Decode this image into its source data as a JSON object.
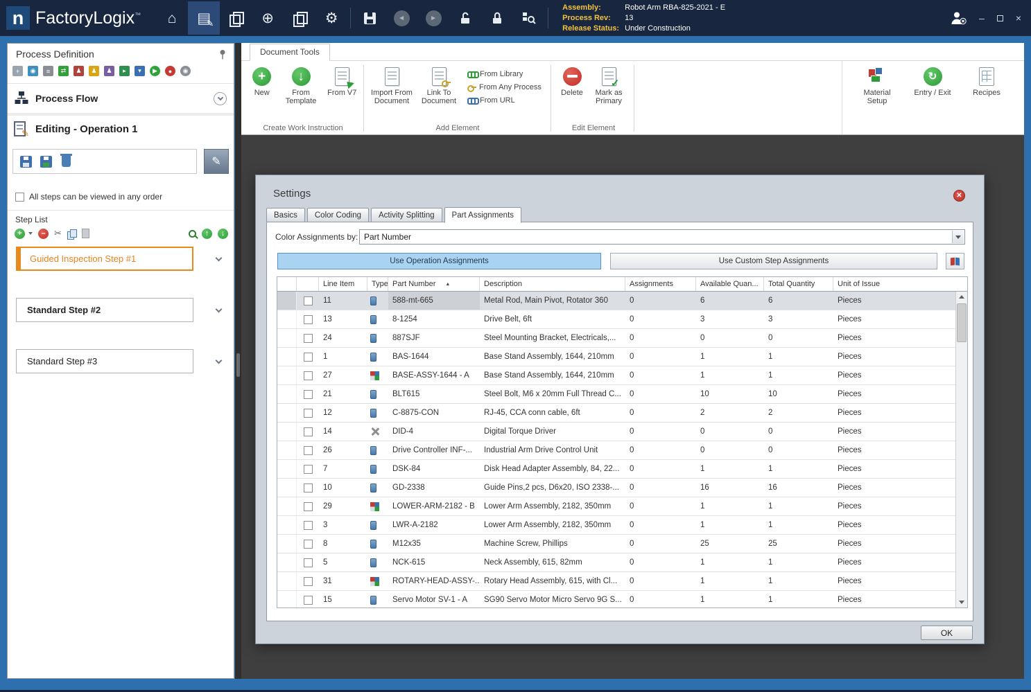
{
  "app": {
    "logo_letter": "n",
    "name": "FactoryLogix",
    "trademark": "™"
  },
  "titlebar": {
    "assembly_label": "Assembly:",
    "assembly_value": "Robot Arm RBA-825-2021 - E",
    "process_rev_label": "Process Rev:",
    "process_rev_value": "13",
    "release_status_label": "Release Status:",
    "release_status_value": "Under Construction",
    "minimize": "–",
    "close": "×"
  },
  "left_panel": {
    "title": "Process Definition",
    "process_flow_label": "Process Flow",
    "editing_label": "Editing - Operation 1",
    "order_checkbox_label": "All steps can be viewed in any order",
    "step_list_label": "Step List",
    "steps": [
      {
        "label": "Guided Inspection Step #1",
        "style": "selected"
      },
      {
        "label": "Standard Step #2",
        "style": "bold"
      },
      {
        "label": "Standard Step #3",
        "style": "normal"
      }
    ]
  },
  "ribbon": {
    "tab_label": "Document Tools",
    "groups": [
      {
        "label": "Create Work Instruction",
        "items": [
          {
            "label": "New"
          },
          {
            "label": "From Template"
          },
          {
            "label": "From V7"
          }
        ]
      },
      {
        "label": "Add Element",
        "items": [
          {
            "label": "Import From Document"
          },
          {
            "label": "Link To Document"
          }
        ],
        "small_items": [
          {
            "label": "From Library"
          },
          {
            "label": "From Any Process"
          },
          {
            "label": "From URL"
          }
        ]
      },
      {
        "label": "Edit Element",
        "items": [
          {
            "label": "Delete"
          },
          {
            "label": "Mark as Primary"
          }
        ]
      }
    ],
    "right_items": [
      {
        "label": "Material Setup"
      },
      {
        "label": "Entry / Exit"
      },
      {
        "label": "Recipes"
      }
    ]
  },
  "dialog": {
    "title": "Settings",
    "tabs": [
      {
        "label": "Basics",
        "active": false
      },
      {
        "label": "Color Coding",
        "active": false
      },
      {
        "label": "Activity Splitting",
        "active": false
      },
      {
        "label": "Part Assignments",
        "active": true
      }
    ],
    "color_by_label": "Color Assignments by:",
    "color_by_value": "Part Number",
    "use_operation_label": "Use Operation Assignments",
    "use_custom_label": "Use Custom Step Assignments",
    "ok_label": "OK",
    "sort_indicator": "▲",
    "table": {
      "columns": [
        "Line Item",
        "Type",
        "Part Number",
        "Description",
        "Assignments",
        "Available Quan...",
        "Total Quantity",
        "Unit of Issue"
      ],
      "rows": [
        {
          "line_item": "11",
          "type": "blue",
          "part_number": "588-mt-665",
          "description": "Metal Rod, Main Pivot, Rotator 360",
          "assignments": "0",
          "available": "6",
          "total": "6",
          "unit": "Pieces",
          "selected": true
        },
        {
          "line_item": "13",
          "type": "blue",
          "part_number": "8-1254",
          "description": "Drive Belt, 6ft",
          "assignments": "0",
          "available": "3",
          "total": "3",
          "unit": "Pieces",
          "selected": false
        },
        {
          "line_item": "24",
          "type": "blue",
          "part_number": "887SJF",
          "description": "Steel Mounting Bracket, Electricals,...",
          "assignments": "0",
          "available": "0",
          "total": "0",
          "unit": "Pieces",
          "selected": false
        },
        {
          "line_item": "1",
          "type": "blue",
          "part_number": "BAS-1644",
          "description": "Base Stand Assembly, 1644, 210mm",
          "assignments": "0",
          "available": "1",
          "total": "1",
          "unit": "Pieces",
          "selected": false
        },
        {
          "line_item": "27",
          "type": "multi",
          "part_number": "BASE-ASSY-1644 - A",
          "description": "Base Stand Assembly, 1644, 210mm",
          "assignments": "0",
          "available": "1",
          "total": "1",
          "unit": "Pieces",
          "selected": false
        },
        {
          "line_item": "21",
          "type": "blue",
          "part_number": "BLT615",
          "description": "Steel Bolt, M6 x 20mm Full Thread C...",
          "assignments": "0",
          "available": "10",
          "total": "10",
          "unit": "Pieces",
          "selected": false
        },
        {
          "line_item": "12",
          "type": "blue",
          "part_number": "C-8875-CON",
          "description": "RJ-45, CCA conn cable, 6ft",
          "assignments": "0",
          "available": "2",
          "total": "2",
          "unit": "Pieces",
          "selected": false
        },
        {
          "line_item": "14",
          "type": "tools",
          "part_number": "DID-4",
          "description": "Digital Torque Driver",
          "assignments": "0",
          "available": "0",
          "total": "0",
          "unit": "Pieces",
          "selected": false
        },
        {
          "line_item": "26",
          "type": "blue",
          "part_number": "Drive Controller INF-...",
          "description": "Industrial Arm Drive Control Unit",
          "assignments": "0",
          "available": "0",
          "total": "0",
          "unit": "Pieces",
          "selected": false
        },
        {
          "line_item": "7",
          "type": "blue",
          "part_number": "DSK-84",
          "description": "Disk Head Adapter Assembly, 84, 22...",
          "assignments": "0",
          "available": "1",
          "total": "1",
          "unit": "Pieces",
          "selected": false
        },
        {
          "line_item": "10",
          "type": "blue",
          "part_number": "GD-2338",
          "description": "Guide Pins,2 pcs, D6x20, ISO 2338-...",
          "assignments": "0",
          "available": "16",
          "total": "16",
          "unit": "Pieces",
          "selected": false
        },
        {
          "line_item": "29",
          "type": "multi",
          "part_number": "LOWER-ARM-2182 - B",
          "description": "Lower Arm Assembly, 2182, 350mm",
          "assignments": "0",
          "available": "1",
          "total": "1",
          "unit": "Pieces",
          "selected": false
        },
        {
          "line_item": "3",
          "type": "blue",
          "part_number": "LWR-A-2182",
          "description": "Lower Arm Assembly, 2182, 350mm",
          "assignments": "0",
          "available": "1",
          "total": "1",
          "unit": "Pieces",
          "selected": false
        },
        {
          "line_item": "8",
          "type": "blue",
          "part_number": "M12x35",
          "description": "Machine Screw, Phillips",
          "assignments": "0",
          "available": "25",
          "total": "25",
          "unit": "Pieces",
          "selected": false
        },
        {
          "line_item": "5",
          "type": "blue",
          "part_number": "NCK-615",
          "description": "Neck Assembly, 615, 82mm",
          "assignments": "0",
          "available": "1",
          "total": "1",
          "unit": "Pieces",
          "selected": false
        },
        {
          "line_item": "31",
          "type": "multi",
          "part_number": "ROTARY-HEAD-ASSY-...",
          "description": "Rotary Head Assembly, 615, with Cl...",
          "assignments": "0",
          "available": "1",
          "total": "1",
          "unit": "Pieces",
          "selected": false
        },
        {
          "line_item": "15",
          "type": "blue",
          "part_number": "Servo Motor SV-1 - A",
          "description": "SG90 Servo Motor Micro Servo 9G S...",
          "assignments": "0",
          "available": "1",
          "total": "1",
          "unit": "Pieces",
          "selected": false
        }
      ]
    }
  },
  "colors": {
    "accent_orange": "#E8821E",
    "selected_button_blue": "#A9D3F0",
    "titlebar_navy": "#18273F",
    "workspace_gray": "#3F3F3F",
    "frame_blue": "#2E6FAE"
  }
}
